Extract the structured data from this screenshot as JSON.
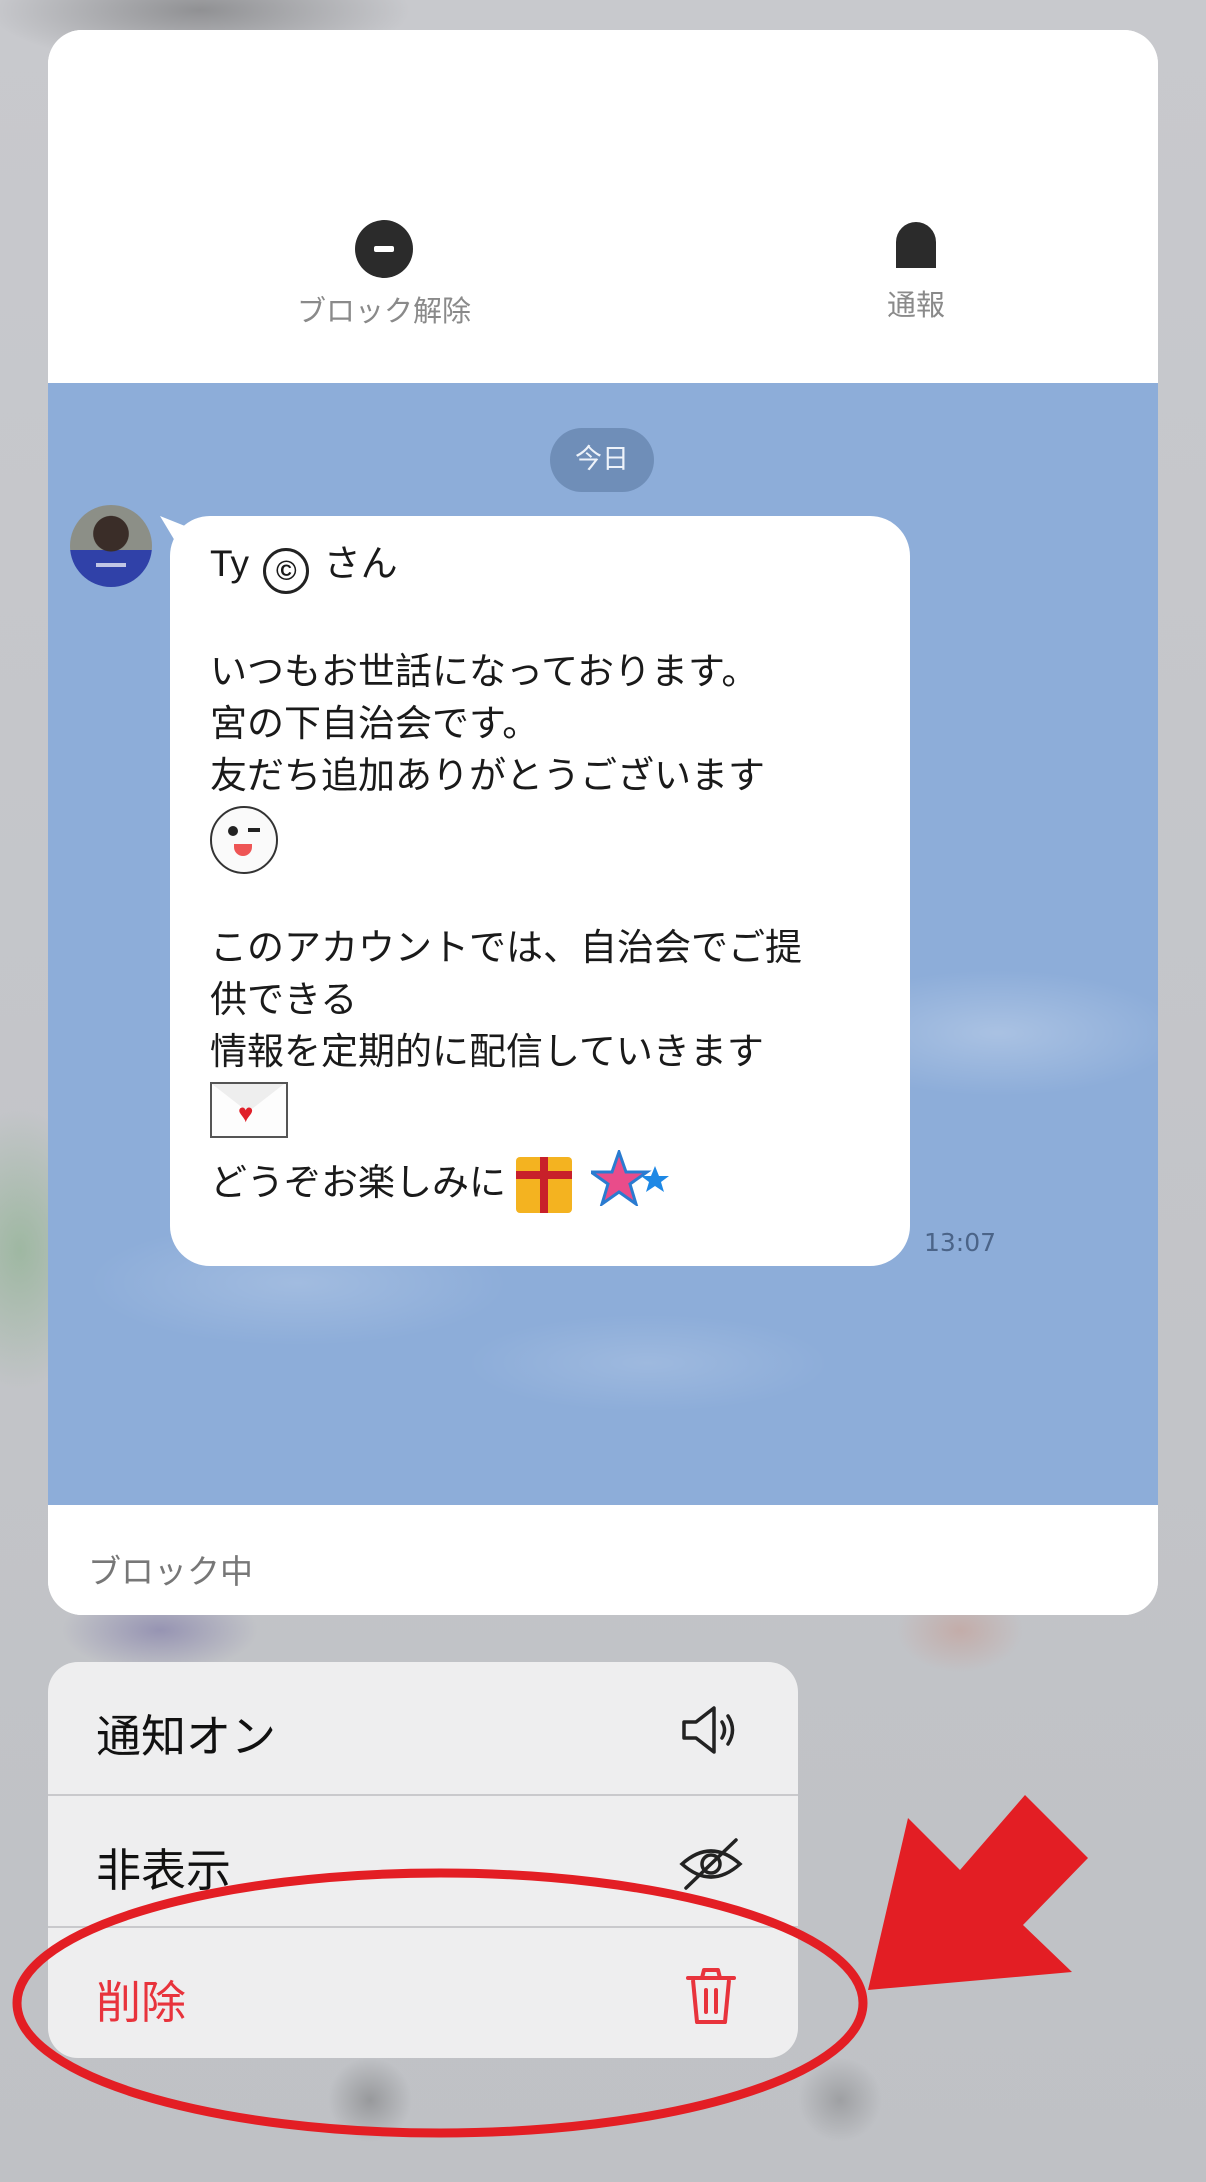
{
  "header": {
    "unblock_label": "ブロック解除",
    "report_label": "通報"
  },
  "chat": {
    "date_label": "今日",
    "message": {
      "lines": [
        "Ty",
        "さん",
        "",
        "いつもお世話になっております。",
        "宮の下自治会です。",
        "友だち追加ありがとうございます",
        "",
        "",
        "このアカウントでは、自治会でご提",
        "供できる",
        "情報を定期的に配信していきます",
        "",
        "どうぞお楽しみに"
      ],
      "circled_mark": "©",
      "time": "13:07"
    }
  },
  "footer": {
    "status": "ブロック中"
  },
  "menu": {
    "items": [
      {
        "label": "通知オン",
        "icon": "speaker-icon"
      },
      {
        "label": "非表示",
        "icon": "eye-off-icon"
      },
      {
        "label": "削除",
        "icon": "trash-icon"
      }
    ]
  },
  "colors": {
    "chat_bg": "#8dadd9",
    "delete_red": "#e8333c",
    "annotation_red": "#e31e24"
  }
}
